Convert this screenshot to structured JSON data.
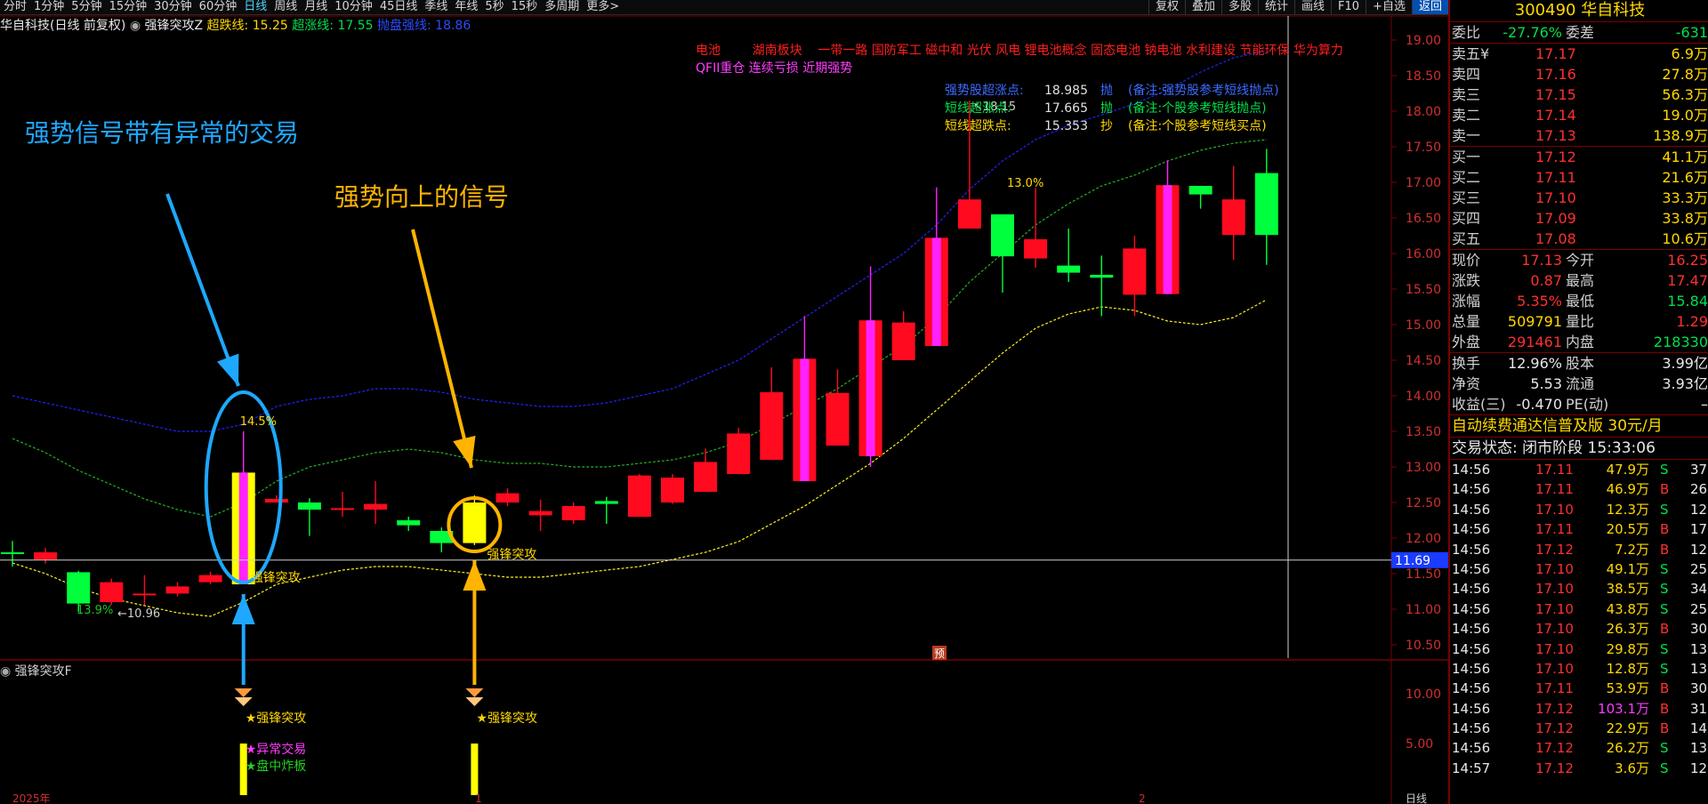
{
  "toolbar": {
    "periods": [
      "分时",
      "1分钟",
      "5分钟",
      "15分钟",
      "30分钟",
      "60分钟",
      "日线",
      "周线",
      "月线",
      "10分钟",
      "45日线",
      "季线",
      "年线",
      "5秒",
      "15秒",
      "多周期",
      "更多>"
    ],
    "active": "日线",
    "right": [
      "复权",
      "叠加",
      "多股",
      "统计",
      "画线",
      "F10",
      "+自选",
      "返回"
    ]
  },
  "title": {
    "stock": "华自科技(日线 前复权)",
    "indicator": "强锋突攻Z",
    "l1": "超跌线:",
    "v1": "15.25",
    "l2": "超涨线:",
    "v2": "17.55",
    "l3": "抛盘强线:",
    "v3": "18.86"
  },
  "concepts": {
    "line1": "电池        湖南板块    一带一路 国防军工 磁中和 光伏 风电 锂电池概念 固态电池 钠电池 水利建设 节能环保 华为算力",
    "line2": "QFII重仓 连续亏损 近期强势"
  },
  "legend": [
    {
      "label": "强势股超涨点:",
      "value": "18.985",
      "tag": "抛",
      "note": "(备注:强势股参考短线抛点)",
      "color": "#3b6bff"
    },
    {
      "label": "短线超涨点:",
      "value": "17.665",
      "tag": "抛",
      "note": "(备注:个股参考短线抛点)",
      "color": "#00e04a"
    },
    {
      "label": "短线超跌点:",
      "value": "15.353",
      "tag": "抄",
      "note": "(备注:个股参考短线买点)",
      "color": "#ffd800"
    }
  ],
  "annotations": {
    "a1": "强势信号带有异常的交易",
    "a2": "强势向上的信号",
    "signal": "强锋突攻",
    "pct1": "14.5%",
    "pct2": "13.0%",
    "pct3": "13.9%",
    "low": "10.96",
    "high": "18.15",
    "pre": "预",
    "crosshair_price": "11.69"
  },
  "subchart": {
    "title": "强锋突攻F",
    "s1": "★强锋突攻",
    "s2": "★异常交易",
    "s3": "★盘中炸板",
    "s4": "★强锋突攻",
    "y_ticks": [
      "10.00",
      "5.00"
    ],
    "x_labels": [
      "2025年",
      "1",
      "2"
    ],
    "period_tag": "日线"
  },
  "chart_data": {
    "type": "candlestick",
    "y_ticks": [
      "19.00",
      "18.50",
      "18.00",
      "17.50",
      "17.00",
      "16.50",
      "16.00",
      "15.50",
      "15.00",
      "14.50",
      "14.00",
      "13.50",
      "13.00",
      "12.50",
      "12.00",
      "11.50",
      "11.00",
      "10.50"
    ],
    "candles": [
      {
        "o": 11.8,
        "c": 11.78,
        "h": 11.96,
        "l": 11.6
      },
      {
        "o": 11.7,
        "c": 11.8,
        "h": 11.86,
        "l": 11.64
      },
      {
        "o": 11.52,
        "c": 11.08,
        "h": 11.54,
        "l": 10.96
      },
      {
        "o": 11.1,
        "c": 11.38,
        "h": 11.43,
        "l": 11.06
      },
      {
        "o": 11.2,
        "c": 11.22,
        "h": 11.48,
        "l": 11.06
      },
      {
        "o": 11.22,
        "c": 11.32,
        "h": 11.38,
        "l": 11.18
      },
      {
        "o": 11.38,
        "c": 11.48,
        "h": 11.53,
        "l": 11.35
      },
      {
        "o": 11.35,
        "c": 12.92,
        "h": 13.5,
        "l": 11.35,
        "special": true
      },
      {
        "o": 12.5,
        "c": 12.55,
        "h": 12.6,
        "l": 12.5
      },
      {
        "o": 12.5,
        "c": 12.4,
        "h": 12.56,
        "l": 12.03
      },
      {
        "o": 12.4,
        "c": 12.42,
        "h": 12.65,
        "l": 12.3
      },
      {
        "o": 12.4,
        "c": 12.48,
        "h": 12.8,
        "l": 12.2
      },
      {
        "o": 12.25,
        "c": 12.18,
        "h": 12.3,
        "l": 12.1
      },
      {
        "o": 12.1,
        "c": 11.93,
        "h": 12.15,
        "l": 11.8
      },
      {
        "o": 11.93,
        "c": 12.5,
        "h": 12.6,
        "l": 11.9,
        "signal": true
      },
      {
        "o": 12.5,
        "c": 12.63,
        "h": 12.7,
        "l": 12.45
      },
      {
        "o": 12.32,
        "c": 12.38,
        "h": 12.54,
        "l": 12.1
      },
      {
        "o": 12.25,
        "c": 12.45,
        "h": 12.5,
        "l": 12.2
      },
      {
        "o": 12.52,
        "c": 12.48,
        "h": 12.58,
        "l": 12.2
      },
      {
        "o": 12.3,
        "c": 12.88,
        "h": 12.9,
        "l": 12.3
      },
      {
        "o": 12.5,
        "c": 12.85,
        "h": 12.9,
        "l": 12.48
      },
      {
        "o": 12.65,
        "c": 13.07,
        "h": 13.26,
        "l": 12.65
      },
      {
        "o": 12.9,
        "c": 13.47,
        "h": 13.55,
        "l": 12.9
      },
      {
        "o": 13.1,
        "c": 14.05,
        "h": 14.4,
        "l": 13.1
      },
      {
        "o": 14.52,
        "c": 12.8,
        "h": 15.12,
        "l": 12.8,
        "special": true
      },
      {
        "o": 13.3,
        "c": 14.04,
        "h": 14.37,
        "l": 13.3
      },
      {
        "o": 13.15,
        "c": 15.06,
        "h": 15.82,
        "l": 13.0,
        "special": true
      },
      {
        "o": 14.5,
        "c": 15.03,
        "h": 15.19,
        "l": 14.5
      },
      {
        "o": 14.7,
        "c": 16.22,
        "h": 16.93,
        "l": 14.7,
        "special": true
      },
      {
        "o": 16.35,
        "c": 16.76,
        "h": 18.15,
        "l": 16.35
      },
      {
        "o": 16.55,
        "c": 15.96,
        "h": 16.55,
        "l": 15.45
      },
      {
        "o": 15.93,
        "c": 16.2,
        "h": 16.92,
        "l": 15.8
      },
      {
        "o": 15.83,
        "c": 15.73,
        "h": 16.35,
        "l": 15.6
      },
      {
        "o": 15.7,
        "c": 15.66,
        "h": 15.97,
        "l": 15.12
      },
      {
        "o": 15.42,
        "c": 16.07,
        "h": 16.25,
        "l": 15.12
      },
      {
        "o": 15.43,
        "c": 16.96,
        "h": 17.31,
        "l": 15.43,
        "special": true
      },
      {
        "o": 16.95,
        "c": 16.83,
        "h": 16.95,
        "l": 16.63
      },
      {
        "o": 16.26,
        "c": 16.76,
        "h": 17.23,
        "l": 15.91
      },
      {
        "o": 17.13,
        "c": 16.26,
        "h": 17.47,
        "l": 15.84
      }
    ],
    "line_upper": [
      14.0,
      13.9,
      13.8,
      13.7,
      13.6,
      13.5,
      13.5,
      13.6,
      13.85,
      13.95,
      14.0,
      14.1,
      14.1,
      14.05,
      13.95,
      13.9,
      13.85,
      13.85,
      13.9,
      14.0,
      14.1,
      14.3,
      14.5,
      14.8,
      15.1,
      15.4,
      15.7,
      16.0,
      16.4,
      16.9,
      17.3,
      17.6,
      17.8,
      17.95,
      18.1,
      18.3,
      18.55,
      18.75,
      18.85
    ],
    "line_mid": [
      13.4,
      13.2,
      12.95,
      12.75,
      12.55,
      12.4,
      12.3,
      12.5,
      12.8,
      13.0,
      13.1,
      13.2,
      13.25,
      13.2,
      13.1,
      13.05,
      13.05,
      13.0,
      13.0,
      13.05,
      13.1,
      13.2,
      13.35,
      13.6,
      13.85,
      14.1,
      14.4,
      14.7,
      15.1,
      15.6,
      16.0,
      16.4,
      16.7,
      16.95,
      17.1,
      17.3,
      17.45,
      17.55,
      17.6
    ],
    "line_lower": [
      11.65,
      11.5,
      11.3,
      11.15,
      11.05,
      10.95,
      10.9,
      11.1,
      11.35,
      11.45,
      11.55,
      11.6,
      11.6,
      11.55,
      11.5,
      11.45,
      11.45,
      11.5,
      11.55,
      11.6,
      11.7,
      11.8,
      11.95,
      12.2,
      12.45,
      12.75,
      13.05,
      13.4,
      13.8,
      14.2,
      14.6,
      14.95,
      15.15,
      15.25,
      15.2,
      15.05,
      15.0,
      15.1,
      15.35
    ],
    "volume_markers": [
      7,
      14
    ]
  },
  "colors": {
    "up": "#ff0a1e",
    "down": "#00ff3c",
    "special": "#ff22ff",
    "signal": "#ffff00",
    "upper": "#2222ff",
    "mid": "#22b022",
    "lower": "#ffee20",
    "axis": "#7a0000"
  },
  "panel": {
    "code": "300490 华自科技",
    "weibi": {
      "l": "委比",
      "v": "-27.76%",
      "l2": "委差",
      "v2": "-631"
    },
    "asks": [
      {
        "l": "卖五",
        "p": "17.17",
        "v": "6.9万",
        "flag": "¥"
      },
      {
        "l": "卖四",
        "p": "17.16",
        "v": "27.8万"
      },
      {
        "l": "卖三",
        "p": "17.15",
        "v": "56.3万"
      },
      {
        "l": "卖二",
        "p": "17.14",
        "v": "19.0万"
      },
      {
        "l": "卖一",
        "p": "17.13",
        "v": "138.9万"
      }
    ],
    "bids": [
      {
        "l": "买一",
        "p": "17.12",
        "v": "41.1万"
      },
      {
        "l": "买二",
        "p": "17.11",
        "v": "21.6万"
      },
      {
        "l": "买三",
        "p": "17.10",
        "v": "33.3万"
      },
      {
        "l": "买四",
        "p": "17.09",
        "v": "33.8万"
      },
      {
        "l": "买五",
        "p": "17.08",
        "v": "10.6万"
      }
    ],
    "stats1": [
      {
        "l": "现价",
        "v": "17.13",
        "c": "red",
        "l2": "今开",
        "v2": "16.25",
        "c2": "red"
      },
      {
        "l": "涨跌",
        "v": "0.87",
        "c": "red",
        "l2": "最高",
        "v2": "17.47",
        "c2": "red"
      },
      {
        "l": "涨幅",
        "v": "5.35%",
        "c": "red",
        "l2": "最低",
        "v2": "15.84",
        "c2": "green"
      },
      {
        "l": "总量",
        "v": "509791",
        "c": "yellow",
        "l2": "量比",
        "v2": "1.29",
        "c2": "red"
      },
      {
        "l": "外盘",
        "v": "291461",
        "c": "red",
        "l2": "内盘",
        "v2": "218330",
        "c2": "green"
      }
    ],
    "stats2": [
      {
        "l": "换手",
        "v": "12.96%",
        "c": "white",
        "l2": "股本",
        "v2": "3.99亿",
        "c2": "white"
      },
      {
        "l": "净资",
        "v": "5.53",
        "c": "white",
        "l2": "流通",
        "v2": "3.93亿",
        "c2": "white"
      },
      {
        "l": "收益(三)",
        "v": "-0.470",
        "c": "white",
        "l2": "PE(动)",
        "v2": "–",
        "c2": "white"
      }
    ],
    "promo": "自动续费通达信普及版  30元/月",
    "state": "交易状态: 闭市阶段 15:33:06",
    "ticks": [
      {
        "t": "14:56",
        "p": "17.11",
        "v": "47.9万",
        "s": "S",
        "n": "37"
      },
      {
        "t": "14:56",
        "p": "17.11",
        "v": "46.9万",
        "s": "B",
        "n": "26"
      },
      {
        "t": "14:56",
        "p": "17.10",
        "v": "12.3万",
        "s": "S",
        "n": "12"
      },
      {
        "t": "14:56",
        "p": "17.11",
        "v": "20.5万",
        "s": "B",
        "n": "17"
      },
      {
        "t": "14:56",
        "p": "17.12",
        "v": "7.2万",
        "s": "B",
        "n": "12"
      },
      {
        "t": "14:56",
        "p": "17.10",
        "v": "49.1万",
        "s": "S",
        "n": "25"
      },
      {
        "t": "14:56",
        "p": "17.10",
        "v": "38.5万",
        "s": "S",
        "n": "34"
      },
      {
        "t": "14:56",
        "p": "17.10",
        "v": "43.8万",
        "s": "S",
        "n": "25"
      },
      {
        "t": "14:56",
        "p": "17.10",
        "v": "26.3万",
        "s": "B",
        "n": "30"
      },
      {
        "t": "14:56",
        "p": "17.10",
        "v": "29.8万",
        "s": "S",
        "n": "13"
      },
      {
        "t": "14:56",
        "p": "17.10",
        "v": "12.8万",
        "s": "S",
        "n": "13"
      },
      {
        "t": "14:56",
        "p": "17.11",
        "v": "53.9万",
        "s": "B",
        "n": "30"
      },
      {
        "t": "14:56",
        "p": "17.12",
        "v": "103.1万",
        "s": "B",
        "n": "31",
        "vc": "magenta"
      },
      {
        "t": "14:56",
        "p": "17.12",
        "v": "22.9万",
        "s": "B",
        "n": "14"
      },
      {
        "t": "14:56",
        "p": "17.12",
        "v": "26.2万",
        "s": "S",
        "n": "13"
      },
      {
        "t": "14:57",
        "p": "17.12",
        "v": "3.6万",
        "s": "S",
        "n": "12"
      }
    ]
  }
}
